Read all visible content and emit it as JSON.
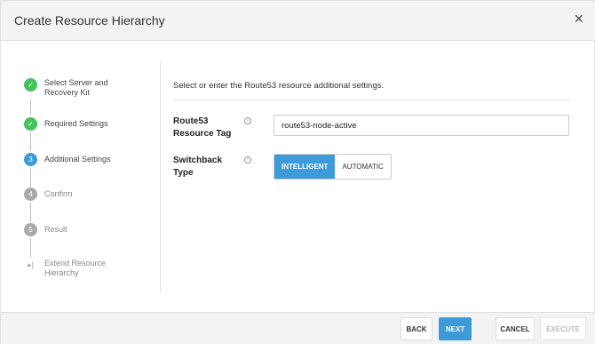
{
  "dialog": {
    "title": "Create Resource Hierarchy",
    "close_symbol": "×"
  },
  "steps": [
    {
      "label_line1": "Select Server and",
      "label_line2": "Recovery Kit",
      "state": "done",
      "number": ""
    },
    {
      "label_line1": "Required Settings",
      "label_line2": "",
      "state": "done",
      "number": ""
    },
    {
      "label_line1": "Additional Settings",
      "label_line2": "",
      "state": "active",
      "number": "3"
    },
    {
      "label_line1": "Confirm",
      "label_line2": "",
      "state": "pending",
      "number": "4"
    },
    {
      "label_line1": "Result",
      "label_line2": "",
      "state": "pending",
      "number": "5"
    },
    {
      "label_line1": "Extend Resource",
      "label_line2": "Hierarchy",
      "state": "extend",
      "number": ""
    }
  ],
  "main": {
    "intro": "Select or enter the Route53 resource additional settings.",
    "fields": {
      "tag": {
        "label_line1": "Route53",
        "label_line2": "Resource Tag",
        "value": "route53-node-active"
      },
      "switchback": {
        "label_line1": "Switchback",
        "label_line2": "Type",
        "options": [
          "INTELLIGENT",
          "AUTOMATIC"
        ],
        "selected": "INTELLIGENT"
      }
    }
  },
  "footer": {
    "back": "BACK",
    "next": "NEXT",
    "cancel": "CANCEL",
    "execute": "EXECUTE"
  },
  "icons": {
    "check": "✓",
    "info": "i",
    "extend": "▸|"
  },
  "colors": {
    "accent": "#3d9bd9",
    "success": "#46c25c",
    "pending": "#aaaaaa"
  }
}
